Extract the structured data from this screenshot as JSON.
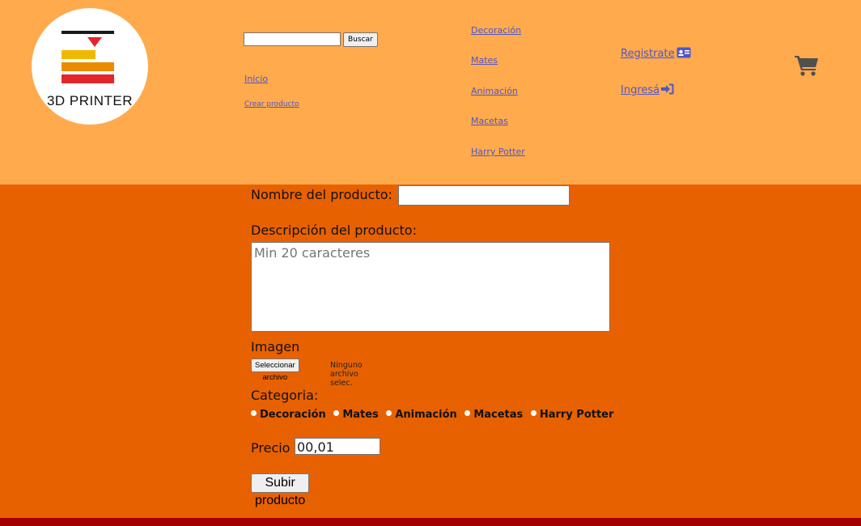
{
  "header": {
    "logo_text": "3D PRINTER",
    "search": {
      "value": "",
      "button_label": "Buscar"
    },
    "nav": {
      "inicio": "Inicio",
      "crear": "Crear producto"
    },
    "categories": [
      "Decoración",
      "Mates",
      "Animación",
      "Macetas",
      "Harry Potter"
    ],
    "auth": {
      "register": "Registrate",
      "login": "Ingresá"
    }
  },
  "form": {
    "name_label": "Nombre del producto:",
    "name_value": "",
    "desc_label": "Descripción del producto:",
    "desc_placeholder": "Min 20 caracteres",
    "image_label": "Imagen",
    "file_button": "Seleccionar archivo",
    "file_status": "Ninguno archivo selec.",
    "category_label": "Categoria:",
    "category_options": [
      "Decoración",
      "Mates",
      "Animación",
      "Macetas",
      "Harry Potter"
    ],
    "price_label": "Precio",
    "price_value": "00,01",
    "submit_label": "Subir producto"
  },
  "colors": {
    "header_bg": "#ffaa4d",
    "body_bg": "#e86100",
    "footer_bg": "#a30000",
    "link": "#4f56c8"
  },
  "icons": [
    "id-card-icon",
    "sign-in-icon",
    "shopping-cart-icon"
  ]
}
